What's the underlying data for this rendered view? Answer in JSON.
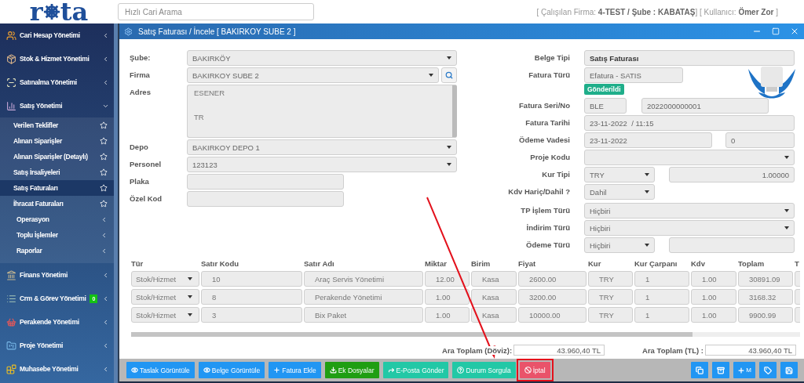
{
  "header": {
    "logo_left": "r",
    "logo_right": "ta",
    "search": {
      "placeholder": "Hızlı Cari Arama"
    },
    "session_info": "[ Çalışılan Firma: **4-TEST / Şube : KABATAŞ**] [ Kullanıcı: **Ömer Zor** ]"
  },
  "sidebar": {
    "items": [
      {
        "label": "Cari Hesap Yönetimi",
        "expanded": false
      },
      {
        "label": "Stok & Hizmet Yönetimi",
        "expanded": false
      },
      {
        "label": "Satınalma Yönetimi",
        "expanded": false
      },
      {
        "label": "Satış Yönetimi",
        "expanded": true,
        "children": [
          {
            "label": "Verilen Teklifler",
            "kind": "page",
            "selected": false
          },
          {
            "label": "Alınan Siparişler",
            "kind": "page",
            "selected": false
          },
          {
            "label": "Alınan Siparişler (Detaylı)",
            "kind": "page",
            "selected": false
          },
          {
            "label": "Satış İrsaliyeleri",
            "kind": "page",
            "selected": false
          },
          {
            "label": "Satış Faturaları",
            "kind": "page",
            "selected": true
          },
          {
            "label": "İhracat Faturaları",
            "kind": "page",
            "selected": false
          },
          {
            "label": "Operasyon",
            "kind": "group",
            "selected": false
          },
          {
            "label": "Toplu İşlemler",
            "kind": "group",
            "selected": false
          },
          {
            "label": "Raporlar",
            "kind": "group",
            "selected": false
          }
        ]
      },
      {
        "label": "Finans Yönetimi",
        "expanded": false
      },
      {
        "label": "Crm & Görev Yönetimi",
        "expanded": false,
        "badge": "0"
      },
      {
        "label": "Perakende Yönetimi",
        "expanded": false
      },
      {
        "label": "Proje Yönetimi",
        "expanded": false
      },
      {
        "label": "Muhasebe Yönetimi",
        "expanded": false
      }
    ]
  },
  "window": {
    "title": "Satış Faturası / İncele [ BAKIRKOY SUBE 2 ]"
  },
  "left_fields": [
    {
      "label": "Şube:",
      "kind": "select",
      "value": "BAKIRKÖY"
    },
    {
      "label": "Firma",
      "kind": "lookup",
      "value": "BAKIRKOY SUBE 2"
    },
    {
      "label": "Adres",
      "kind": "textarea",
      "lines": [
        "ESENER",
        "TR"
      ]
    },
    {
      "label": "Depo",
      "kind": "select",
      "value": "BAKIRKOY DEPO 1"
    },
    {
      "label": "Personel",
      "kind": "select",
      "value": "123123"
    },
    {
      "label": "Plaka",
      "kind": "short"
    },
    {
      "label": "Özel Kod",
      "kind": "short"
    }
  ],
  "right_fields": [
    {
      "label": "Belge Tipi",
      "kind": "single",
      "controls": [
        {
          "kind": "text",
          "value": "Satış Faturası",
          "bold": true
        }
      ]
    },
    {
      "label": "Fatura Türü",
      "kind": "single-short",
      "badge": "Gönderildi",
      "controls": [
        {
          "kind": "text",
          "value": "Efatura - SATIS"
        }
      ]
    },
    {
      "label": "Fatura Seri/No",
      "kind": "series",
      "controls": [
        {
          "kind": "text",
          "value": "BLE"
        },
        {
          "kind": "text",
          "value": "2022000000001"
        }
      ]
    },
    {
      "label": "Fatura Tarihi",
      "kind": "single",
      "controls": [
        {
          "kind": "text",
          "value": "23-11-2022  / 11:15"
        }
      ]
    },
    {
      "label": "Ödeme Vadesi",
      "kind": "split-wide",
      "controls": [
        {
          "kind": "text",
          "value": "23-11-2022"
        },
        {
          "kind": "text",
          "value": "0"
        }
      ]
    },
    {
      "label": "Proje Kodu",
      "kind": "single",
      "controls": [
        {
          "kind": "select"
        }
      ]
    },
    {
      "label": "Kur Tipi",
      "kind": "split-narrow",
      "controls": [
        {
          "kind": "select",
          "value": "TRY"
        },
        {
          "kind": "number",
          "value": "1.00000"
        }
      ]
    },
    {
      "label": "Kdv Hariç/Dahil ?",
      "kind": "select-short",
      "controls": [
        {
          "kind": "select",
          "value": "Dahil"
        }
      ]
    },
    {
      "label": "TP İşlem Türü",
      "kind": "single",
      "controls": [
        {
          "kind": "select",
          "value": "Hiçbiri"
        }
      ]
    },
    {
      "label": "İndirim Türü",
      "kind": "single",
      "controls": [
        {
          "kind": "select",
          "value": "Hiçbiri"
        }
      ]
    },
    {
      "label": "Ödeme Türü",
      "kind": "split-narrow",
      "controls": [
        {
          "kind": "select",
          "value": "Hiçbiri"
        },
        {
          "kind": "text"
        }
      ]
    }
  ],
  "table": {
    "columns": [
      "Tür",
      "Satır Kodu",
      "Satır Adı",
      "Miktar",
      "Birim",
      "Fiyat",
      "Kur",
      "Kur Çarpanı",
      "Kdv",
      "Toplam",
      "T"
    ],
    "rows": [
      [
        "Stok/Hizmet",
        "10",
        "Araç Servis Yönetimi",
        "12.00",
        "Kasa",
        "2600.00",
        "TRY",
        "1",
        "1.00",
        "30891.09"
      ],
      [
        "Stok/Hizmet",
        "8",
        "Perakende Yönetimi",
        "1.00",
        "Kasa",
        "3200.00",
        "TRY",
        "1",
        "1.00",
        "3168.32"
      ],
      [
        "Stok/Hizmet",
        "3",
        "Bix Paket",
        "1.00",
        "Kasa",
        "10000.00",
        "TRY",
        "1",
        "1.00",
        "9900.99"
      ]
    ]
  },
  "totals": [
    {
      "label": "Ara Toplam (Döviz):",
      "value": "43.960,40 TL"
    },
    {
      "label": "Ara Toplam (TL) :",
      "value": "43.960,40 TL"
    }
  ],
  "toolbar": {
    "buttons": [
      {
        "label": "Taslak Görüntüle",
        "kind": "primary",
        "highlighted": false
      },
      {
        "label": "Belge Görüntüle",
        "kind": "primary",
        "highlighted": false
      },
      {
        "label": "Fatura Ekle",
        "kind": "primary",
        "highlighted": false
      },
      {
        "label": "Ek Dosyalar",
        "kind": "success",
        "highlighted": false
      },
      {
        "label": "E-Posta Gönder",
        "kind": "info",
        "highlighted": false
      },
      {
        "label": "Durum Sorgula",
        "kind": "info",
        "highlighted": false
      },
      {
        "label": "İptal",
        "kind": "danger",
        "highlighted": true
      }
    ],
    "icon_buttons": [
      {
        "kind": "copy"
      },
      {
        "kind": "box"
      },
      {
        "kind": "add",
        "label": "M"
      },
      {
        "kind": "tag"
      },
      {
        "kind": "save"
      }
    ]
  }
}
